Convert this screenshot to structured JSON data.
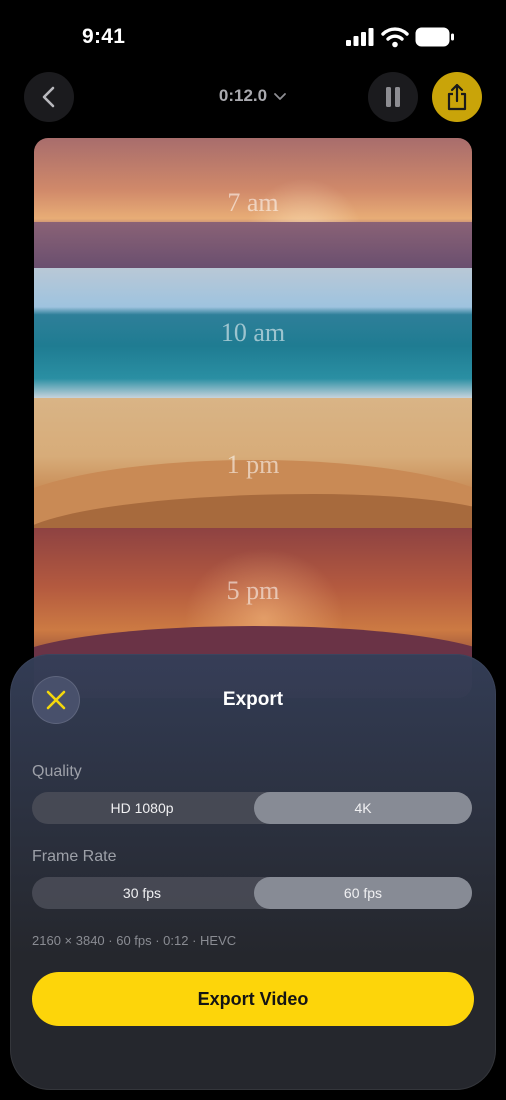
{
  "status_bar": {
    "time": "9:41"
  },
  "nav": {
    "back_icon": "chevron-left-icon",
    "duration": "0:12.0",
    "duration_icon": "chevron-down-icon",
    "pause_icon": "pause-icon",
    "share_icon": "share-icon"
  },
  "timeline": {
    "frames": [
      {
        "label": "7 am"
      },
      {
        "label": "10 am"
      },
      {
        "label": "1 pm"
      },
      {
        "label": "5 pm"
      }
    ]
  },
  "export_sheet": {
    "title": "Export",
    "close_icon": "close-icon",
    "quality": {
      "label": "Quality",
      "options": [
        "HD 1080p",
        "4K"
      ],
      "selected": "4K"
    },
    "frame_rate": {
      "label": "Frame Rate",
      "options": [
        "30 fps",
        "60 fps"
      ],
      "selected": "60 fps"
    },
    "specs": "2160 × 3840 · 60 fps · 0:12 · HEVC",
    "export_button": "Export Video"
  },
  "colors": {
    "accent": "#fdd50a",
    "share_button": "#c9a409",
    "background": "#000000"
  }
}
